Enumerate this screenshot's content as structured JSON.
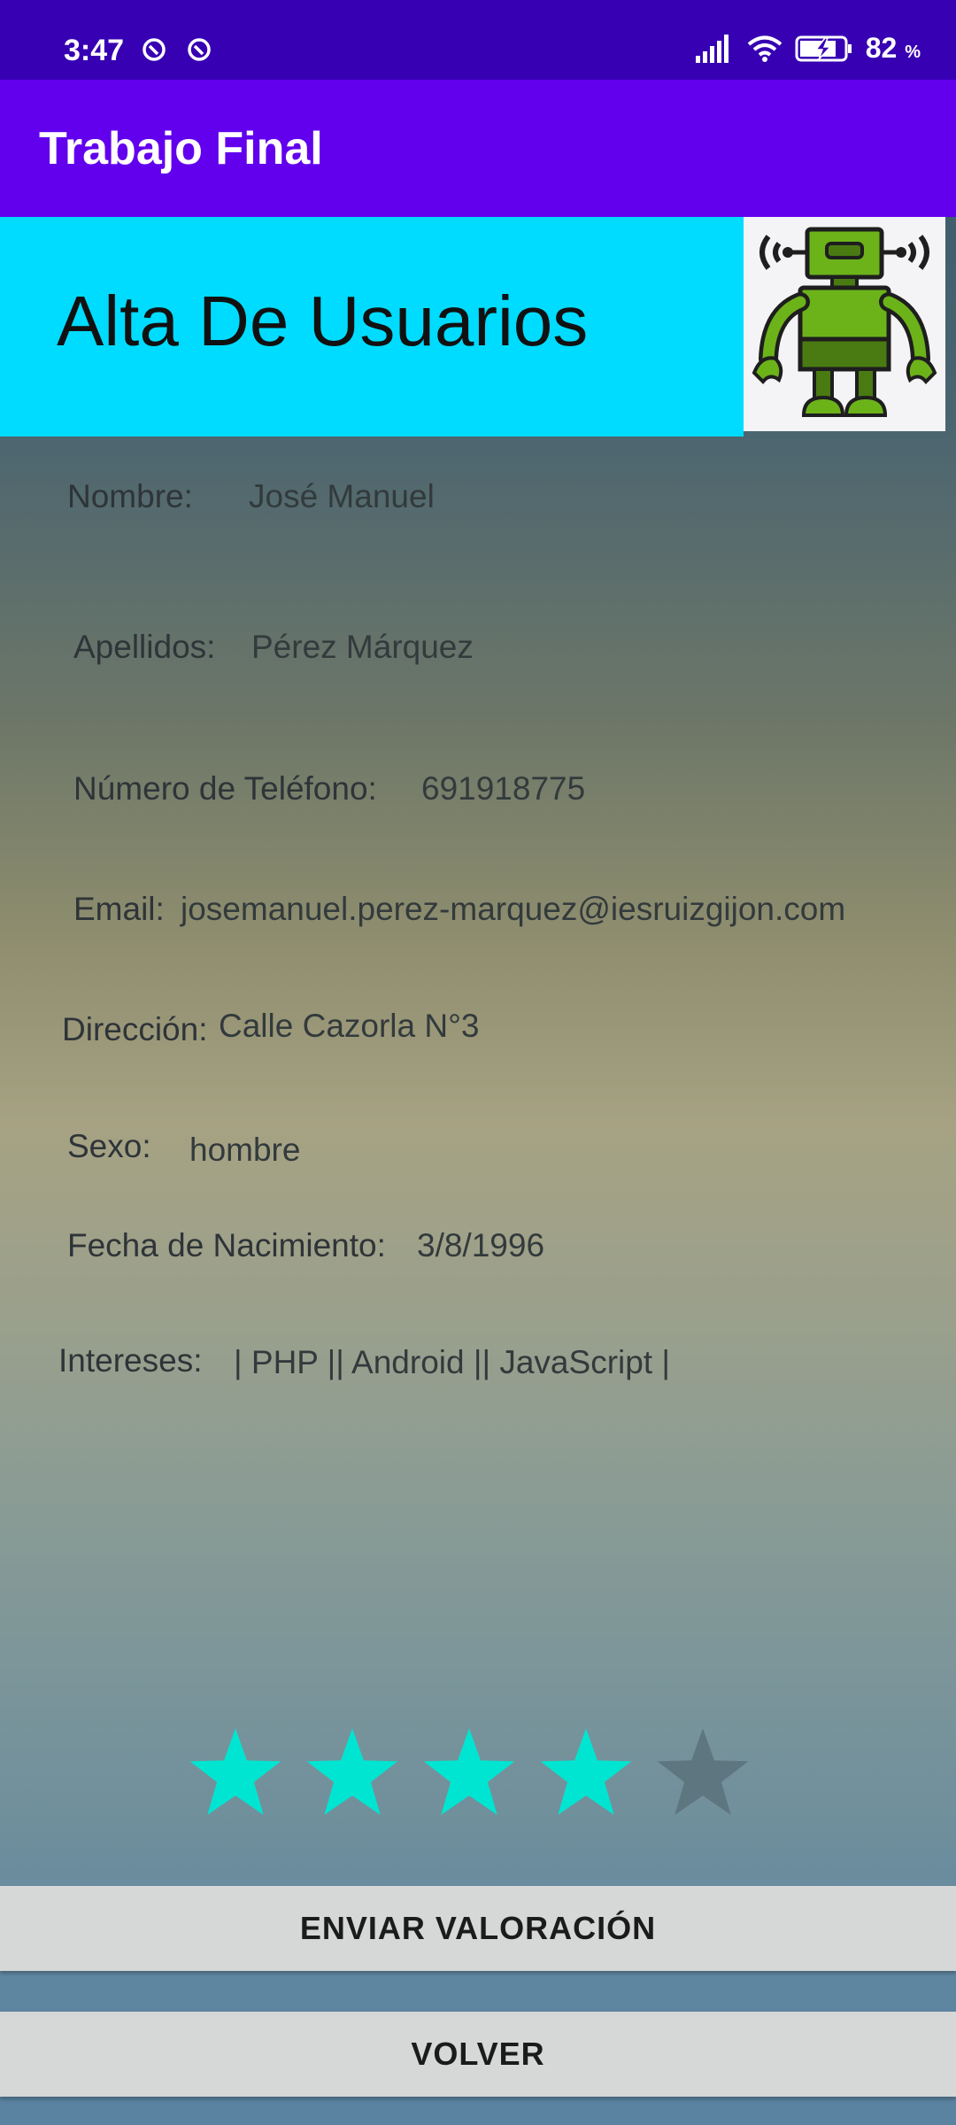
{
  "status_bar": {
    "time": "3:47",
    "battery": "82",
    "battery_unit": "%",
    "icons": [
      "app-notification-icon",
      "app-notification-icon",
      "signal-icon",
      "wifi-icon",
      "battery-charging-icon"
    ]
  },
  "app_bar": {
    "title": "Trabajo Final"
  },
  "header": {
    "title": "Alta De Usuarios",
    "image": "robot-icon"
  },
  "fields": {
    "nombre": {
      "label": "Nombre:",
      "value": "José Manuel"
    },
    "apellidos": {
      "label": "Apellidos:",
      "value": "Pérez Márquez"
    },
    "telefono": {
      "label": "Número de Teléfono:",
      "value": "691918775"
    },
    "email": {
      "label": "Email:",
      "value": "josemanuel.perez-marquez@iesruizgijon.com"
    },
    "direccion": {
      "label": "Dirección:",
      "value": "Calle Cazorla N°3"
    },
    "sexo": {
      "label": "Sexo:",
      "value": "hombre"
    },
    "nacimiento": {
      "label": "Fecha de Nacimiento:",
      "value": "3/8/1996"
    },
    "intereses": {
      "label": "Intereses:",
      "value": "| PHP || Android || JavaScript |"
    }
  },
  "rating": {
    "value": 4,
    "max": 5,
    "filled_color": "#00e5d1",
    "empty_color": "#5d7680"
  },
  "buttons": {
    "send": "ENVIAR VALORACIÓN",
    "back": "VOLVER"
  },
  "colors": {
    "status_bar": "#3700b3",
    "app_bar": "#6200ee",
    "header_banner": "#00dcff"
  }
}
